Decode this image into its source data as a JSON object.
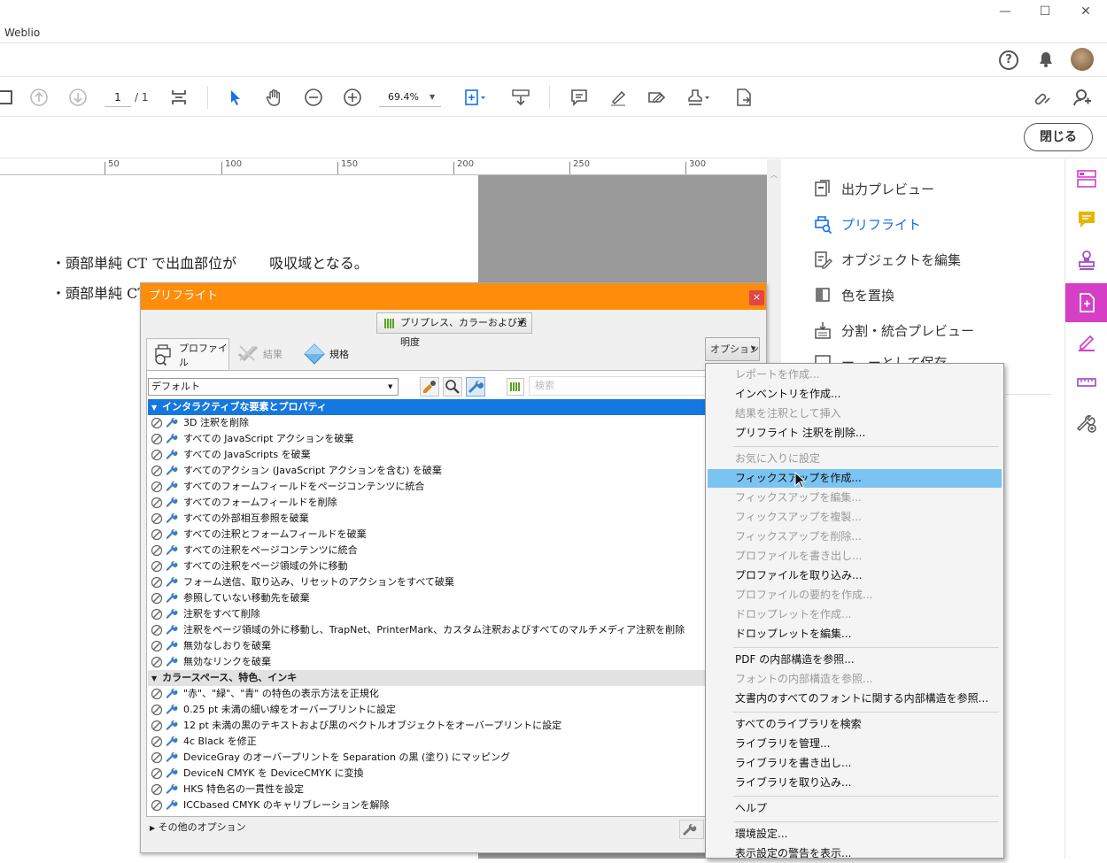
{
  "window": {
    "app_title": "Weblio",
    "minimize": "—",
    "maximize": "☐",
    "close": "✕"
  },
  "toolbar": {
    "page_current": "1",
    "page_total": "/ 1",
    "zoom": "69.4%"
  },
  "close_button": "閉じる",
  "ruler": {
    "labels": [
      "50",
      "100",
      "150",
      "200",
      "250",
      "300"
    ]
  },
  "document": {
    "line1": "・頭部単純 CT で出血部位が　　  吸収域となる。",
    "line2": "・頭部単純 CT"
  },
  "right_panel": {
    "items": [
      "出力プレビュー",
      "プリフライト",
      "オブジェクトを編集",
      "色を置換",
      "分割・統合プレビュー",
      "ー　ーとして保存"
    ]
  },
  "dialog": {
    "title": "プリフライト",
    "preset": "プリプレス、カラーおよび透明度",
    "tabs": [
      "プロファイル",
      "結果",
      "規格"
    ],
    "options_label": "オプション",
    "profile_select": "デフォルト",
    "search_placeholder": "検索",
    "groups": [
      {
        "label": "インタラクティブな要素とプロパティ",
        "items": [
          "3D 注釈を削除",
          "すべての JavaScript アクションを破棄",
          "すべての JavaScripts を破棄",
          "すべてのアクション (JavaScript アクションを含む) を破棄",
          "すべてのフォームフィールドをページコンテンツに統合",
          "すべてのフォームフィールドを削除",
          "すべての外部相互参照を破棄",
          "すべての注釈とフォームフィールドを破棄",
          "すべての注釈をページコンテンツに統合",
          "すべての注釈をページ領域の外に移動",
          "フォーム送信、取り込み、リセットのアクションをすべて破棄",
          "参照していない移動先を破棄",
          "注釈をすべて削除",
          "注釈をページ領域の外に移動し、TrapNet、PrinterMark、カスタム注釈およびすべてのマルチメディア注釈を削除",
          "無効なしおりを破棄",
          "無効なリンクを破棄"
        ]
      },
      {
        "label": "カラースペース、特色、インキ",
        "items": [
          "\"赤\"、\"緑\"、\"青\" の特色の表示方法を正規化",
          "0.25 pt 未満の細い線をオーバープリントに設定",
          "12 pt 未満の黒のテキストおよび黒のベクトルオブジェクトをオーバープリントに設定",
          "4c Black を修正",
          "DeviceGray のオーバープリントを Separation の黒 (塗り) にマッピング",
          "DeviceN CMYK を DeviceCMYK に変換",
          "HKS 特色名の一貫性を設定",
          "ICCbased CMYK のキャリブレーションを解除"
        ]
      }
    ],
    "more_options": "その他のオプション"
  },
  "menu": {
    "items": [
      {
        "label": "レポートを作成...",
        "disabled": true
      },
      {
        "label": "インベントリを作成...",
        "disabled": false
      },
      {
        "label": "結果を注釈として挿入",
        "disabled": true
      },
      {
        "label": "プリフライト 注釈を削除...",
        "disabled": false
      },
      {
        "label": "お気に入りに設定",
        "disabled": true
      },
      {
        "label": "フィックスアップを作成...",
        "disabled": false
      },
      {
        "label": "フィックスアップを編集...",
        "disabled": true
      },
      {
        "label": "フィックスアップを複製...",
        "disabled": true
      },
      {
        "label": "フィックスアップを削除...",
        "disabled": true
      },
      {
        "label": "プロファイルを書き出し...",
        "disabled": true
      },
      {
        "label": "プロファイルを取り込み...",
        "disabled": false
      },
      {
        "label": "プロファイルの要約を作成...",
        "disabled": true
      },
      {
        "label": "ドロップレットを作成...",
        "disabled": true
      },
      {
        "label": "ドロップレットを編集...",
        "disabled": false
      },
      {
        "label": "PDF の内部構造を参照...",
        "disabled": false
      },
      {
        "label": "フォントの内部構造を参照...",
        "disabled": true
      },
      {
        "label": "文書内のすべてのフォントに関する内部構造を参照...",
        "disabled": false
      },
      {
        "label": "すべてのライブラリを検索",
        "disabled": false
      },
      {
        "label": "ライブラリを管理...",
        "disabled": false
      },
      {
        "label": "ライブラリを書き出し...",
        "disabled": false
      },
      {
        "label": "ライブラリを取り込み...",
        "disabled": false
      },
      {
        "label": "ヘルプ",
        "disabled": false
      },
      {
        "label": "環境設定...",
        "disabled": false
      },
      {
        "label": "表示設定の警告を表示...",
        "disabled": false
      }
    ],
    "highlighted": "フィックスアップを作成..."
  },
  "colors": {
    "accent": "#1473e6",
    "dialog_title": "#ff8c0a",
    "highlight": "#7bc4f2",
    "sidebar_accent": "#d53fc6"
  }
}
